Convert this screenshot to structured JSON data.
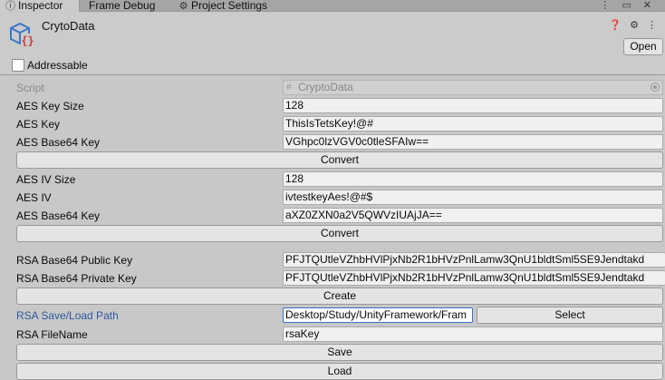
{
  "tabs": [
    {
      "label": "Inspector",
      "icon": "info-icon",
      "active": true
    },
    {
      "label": "Frame Debug",
      "icon": "",
      "active": false
    },
    {
      "label": "Project Settings",
      "icon": "gear-icon",
      "active": false
    }
  ],
  "tab_tools": "⋮ ▭ ✕",
  "asset": {
    "title": "CrytoData",
    "open_label": "Open"
  },
  "header_tools": "❓ ⚙ ⋮",
  "addressable": {
    "label": "Addressable",
    "checked": false
  },
  "script": {
    "label": "Script",
    "value": "CryptoData"
  },
  "aes": {
    "key_size_label": "AES Key Size",
    "key_size_value": "128",
    "key_label": "AES Key",
    "key_value": "ThisIsTetsKey!@#",
    "b64_label": "AES Base64 Key",
    "b64_value": "VGhpc0lzVGV0c0tleSFAIw==",
    "convert_label": "Convert",
    "iv_size_label": "AES IV Size",
    "iv_size_value": "128",
    "iv_label": "AES IV",
    "iv_value": "ivtestkeyAes!@#$",
    "iv_b64_label": "AES Base64 Key",
    "iv_b64_value": "aXZ0ZXN0a2V5QWVzIUAjJA==",
    "convert2_label": "Convert"
  },
  "rsa": {
    "pub_label": "RSA Base64 Public Key",
    "pub_value": "PFJTQUtleVZhbHVlPjxNb2R1bHVzPnlLamw3QnU1bldtSml5SE9Jendtakd",
    "priv_label": "RSA Base64 Private Key",
    "priv_value": "PFJTQUtleVZhbHVlPjxNb2R1bHVzPnlLamw3QnU1bldtSml5SE9Jendtakd",
    "create_label": "Create",
    "path_label": "RSA Save/Load Path",
    "path_value": "Desktop/Study/UnityFramework/Fram",
    "select_label": "Select",
    "filename_label": "RSA FileName",
    "filename_value": "rsaKey",
    "save_label": "Save",
    "load_label": "Load"
  },
  "colors": {
    "accent": "#2e5a9e",
    "panel": "#c8c8c8",
    "field": "#f0f0f0"
  }
}
